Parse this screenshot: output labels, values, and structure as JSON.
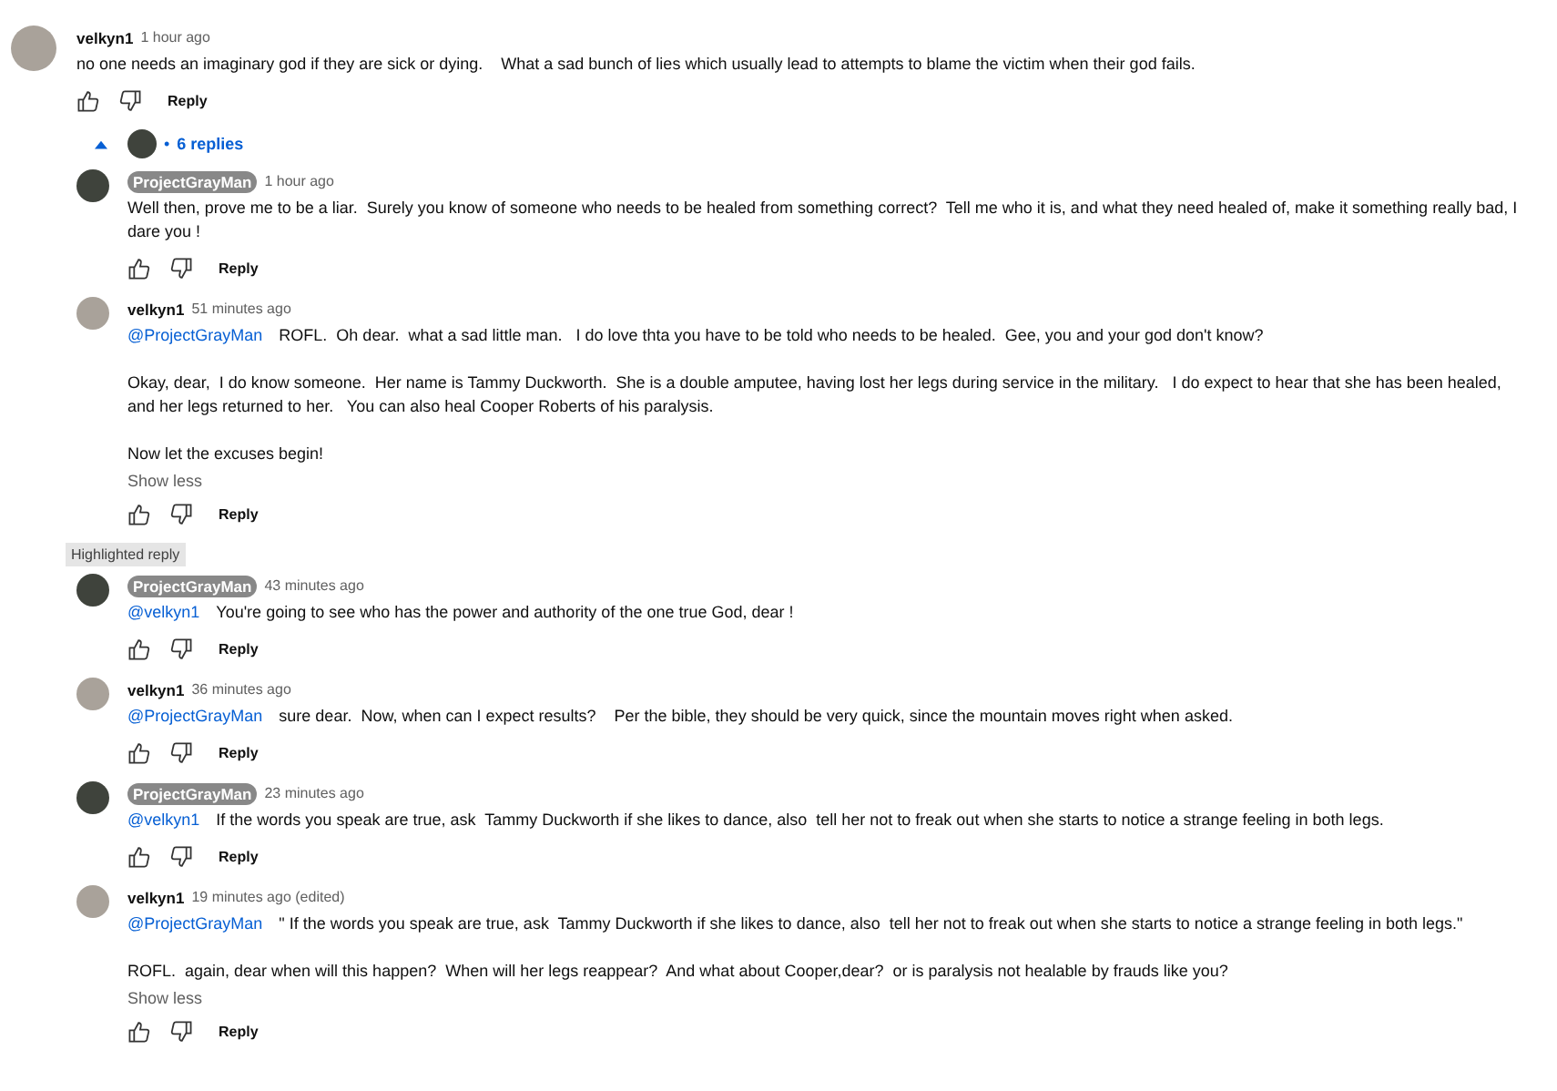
{
  "comment": {
    "author": "velkyn1",
    "owner": false,
    "time": "1 hour ago",
    "paragraphs": [
      {
        "text": "no one needs an imaginary god if they are sick or dying.    What a sad bunch of lies which usually lead to attempts to blame the victim when their god fails."
      }
    ],
    "reply_label": "Reply"
  },
  "replies_toggle": {
    "expanded": true,
    "bullet": "•",
    "label": "6 replies"
  },
  "replies": [
    {
      "author": "ProjectGrayMan",
      "owner": true,
      "time": "1 hour ago",
      "paragraphs": [
        {
          "text": "Well then, prove me to be a liar.  Surely you know of someone who needs to be healed from something correct?  Tell me who it is, and what they need healed of, make it something really bad, I dare you !"
        }
      ],
      "reply_label": "Reply"
    },
    {
      "author": "velkyn1",
      "owner": false,
      "time": "51 minutes ago",
      "paragraphs": [
        {
          "mention": "@ProjectGrayMan",
          "text": "ROFL.  Oh dear.  what a sad little man.   I do love thta you have to be told who needs to be healed.  Gee, you and your god don't know?"
        },
        {
          "text": "Okay, dear,  I do know someone.  Her name is Tammy Duckworth.  She is a double amputee, having lost her legs during service in the military.   I do expect to hear that she has been healed, and her legs returned to her.   You can also heal Cooper Roberts of his paralysis."
        },
        {
          "text": "Now let the excuses begin!"
        }
      ],
      "show_less": "Show less",
      "reply_label": "Reply"
    },
    {
      "highlight_label": "Highlighted reply",
      "author": "ProjectGrayMan",
      "owner": true,
      "time": "43 minutes ago",
      "paragraphs": [
        {
          "mention": "@velkyn1",
          "text": "You're going to see who has the power and authority of the one true God, dear !"
        }
      ],
      "reply_label": "Reply"
    },
    {
      "author": "velkyn1",
      "owner": false,
      "time": "36 minutes ago",
      "paragraphs": [
        {
          "mention": "@ProjectGrayMan",
          "text": "sure dear.  Now, when can I expect results?    Per the bible, they should be very quick, since the mountain moves right when asked."
        }
      ],
      "reply_label": "Reply"
    },
    {
      "author": "ProjectGrayMan",
      "owner": true,
      "time": "23 minutes ago",
      "paragraphs": [
        {
          "mention": "@velkyn1",
          "text": "If the words you speak are true, ask  Tammy Duckworth if she likes to dance, also  tell her not to freak out when she starts to notice a strange feeling in both legs."
        }
      ],
      "reply_label": "Reply"
    },
    {
      "author": "velkyn1",
      "owner": false,
      "time": "19 minutes ago (edited)",
      "paragraphs": [
        {
          "mention": "@ProjectGrayMan",
          "text": "\" If the words you speak are true, ask  Tammy Duckworth if she likes to dance, also  tell her not to freak out when she starts to notice a strange feeling in both legs.\""
        },
        {
          "text": "ROFL.  again, dear when will this happen?  When will her legs reappear?  And what about Cooper,dear?  or is paralysis not healable by frauds like you?"
        }
      ],
      "show_less": "Show less",
      "reply_label": "Reply"
    }
  ]
}
